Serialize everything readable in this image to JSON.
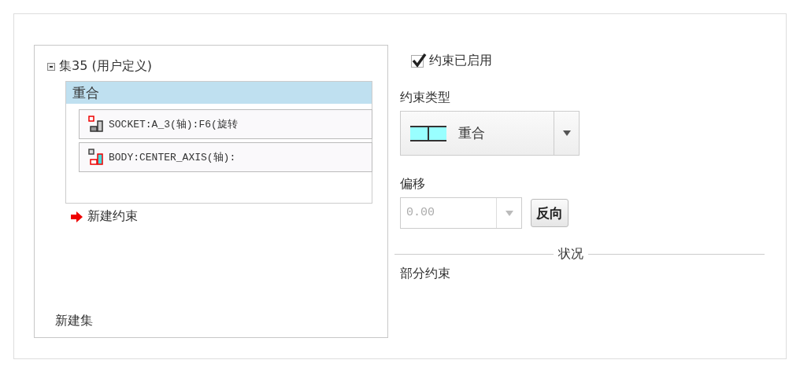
{
  "constraint_set": {
    "label": "集35 (用户定义)",
    "expanded": true,
    "constraints": [
      {
        "label": "重合",
        "selected": true,
        "references": [
          {
            "text": "SOCKET:A_3(轴):F6(旋转"
          },
          {
            "text": "BODY:CENTER_AXIS(轴):"
          }
        ]
      }
    ],
    "new_constraint": "新建约束"
  },
  "new_set": "新建集",
  "enabled": {
    "label": "约束已启用",
    "checked": true
  },
  "type": {
    "label": "约束类型",
    "value": "重合"
  },
  "offset": {
    "label": "偏移",
    "value": "0.00",
    "disabled": true,
    "flip_button": "反向"
  },
  "status": {
    "title": "状况",
    "text": "部分约束"
  }
}
